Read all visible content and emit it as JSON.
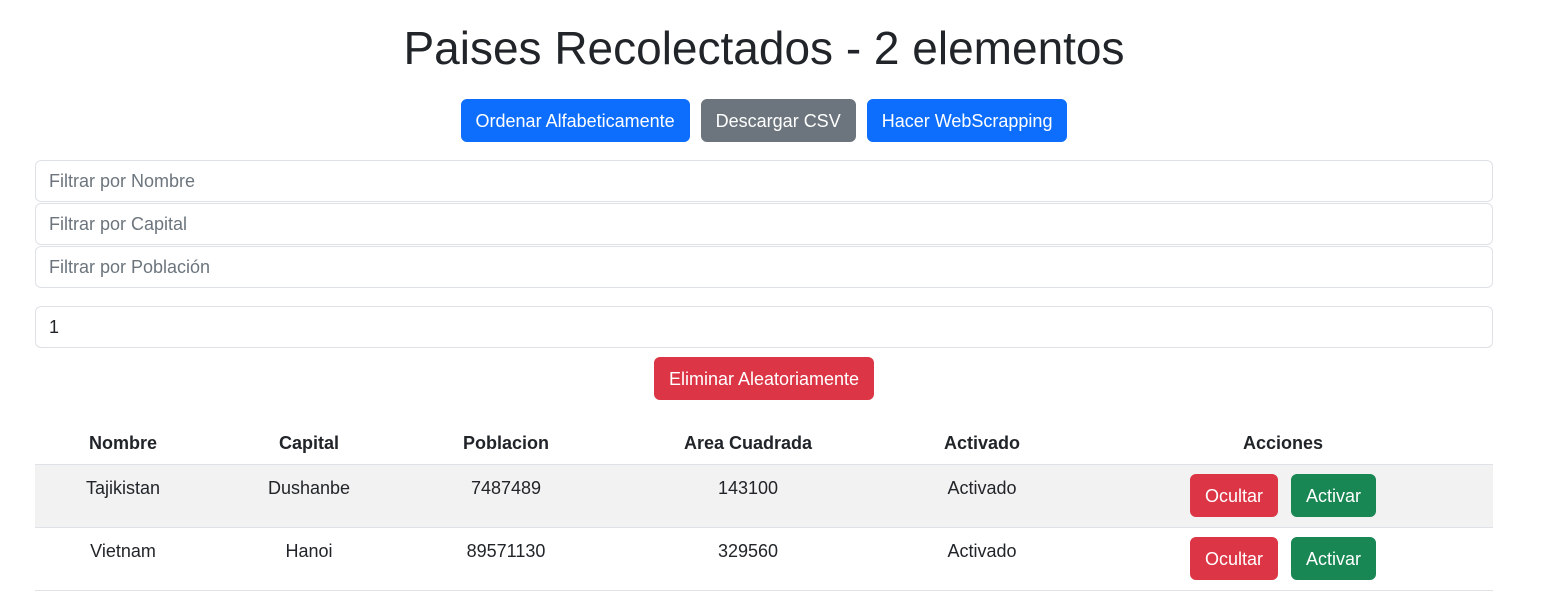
{
  "header": {
    "title": "Paises Recolectados - 2 elementos"
  },
  "toolbar": {
    "sort_label": "Ordenar Alfabeticamente",
    "csv_label": "Descargar CSV",
    "scrape_label": "Hacer WebScrapping"
  },
  "filters": {
    "name_placeholder": "Filtrar por Nombre",
    "capital_placeholder": "Filtrar por Capital",
    "population_placeholder": "Filtrar por Población"
  },
  "count_input": {
    "value": "1"
  },
  "delete_random_label": "Eliminar Aleatoriamente",
  "table": {
    "headers": [
      "Nombre",
      "Capital",
      "Poblacion",
      "Area Cuadrada",
      "Activado",
      "Acciones"
    ],
    "rows": [
      {
        "nombre": "Tajikistan",
        "capital": "Dushanbe",
        "poblacion": "7487489",
        "area": "143100",
        "activado": "Activado",
        "hide_label": "Ocultar",
        "activate_label": "Activar"
      },
      {
        "nombre": "Vietnam",
        "capital": "Hanoi",
        "poblacion": "89571130",
        "area": "329560",
        "activado": "Activado",
        "hide_label": "Ocultar",
        "activate_label": "Activar"
      }
    ]
  }
}
